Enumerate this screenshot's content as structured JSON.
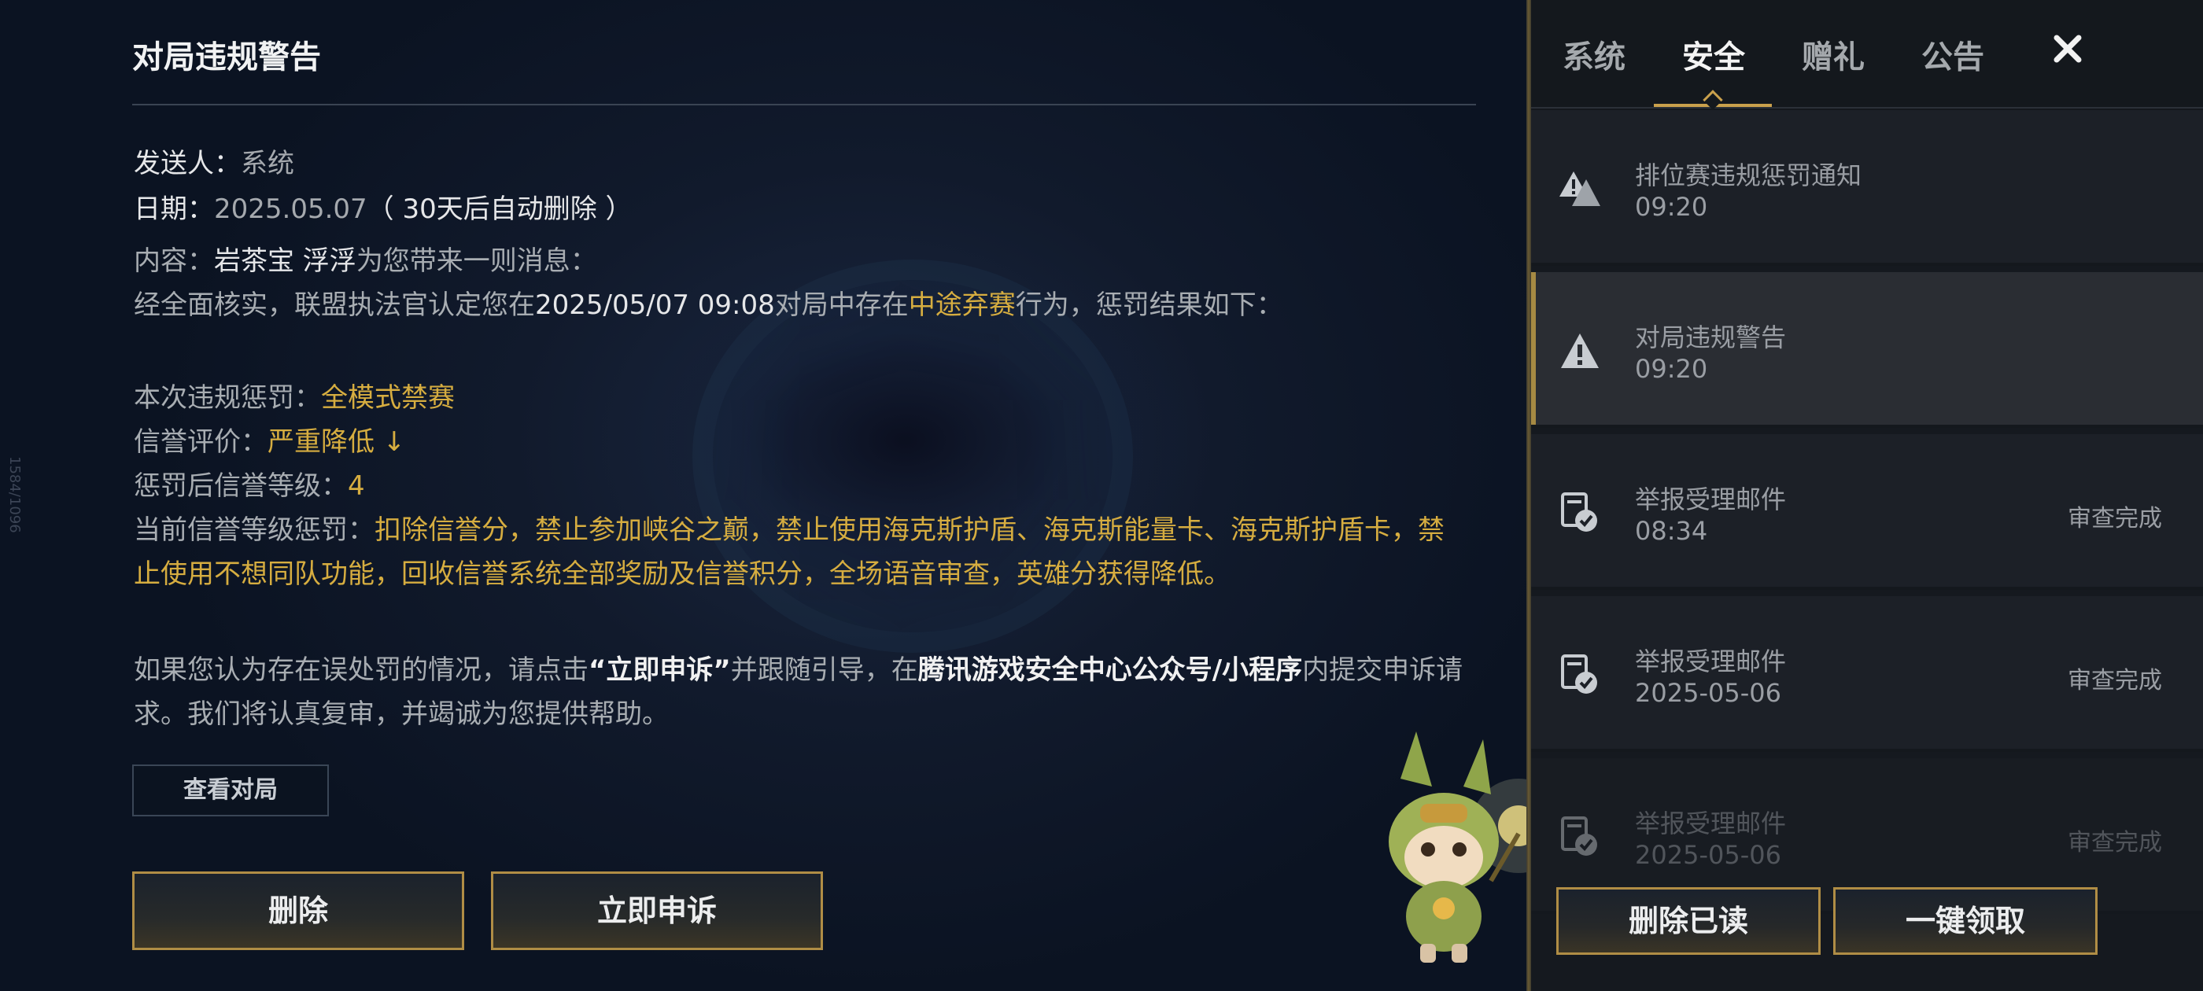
{
  "side_number": "1584/1096",
  "detail": {
    "title": "对局违规警告",
    "sender_label": "发送人：",
    "sender": "系统",
    "date_label": "日期：",
    "date": "2025.05.07",
    "auto_delete": "（ 30天后自动删除 ）",
    "content_label": "内容：",
    "content_from": "岩茶宝 浮浮",
    "content_from_suffix": "为您带来一则消息：",
    "verdict_pre": "经全面核实，联盟执法官认定您在",
    "verdict_time": "2025/05/07 09:08",
    "verdict_mid": "对局中存在",
    "verdict_behavior": "中途弃赛",
    "verdict_post": "行为，惩罚结果如下：",
    "penalty_label": "本次违规惩罚：",
    "penalty": "全模式禁赛",
    "credit_label": "信誉评价：",
    "credit": "严重降低 ↓",
    "level_label": "惩罚后信誉等级：",
    "level": "4",
    "current_label": "当前信誉等级惩罚：",
    "current": "扣除信誉分，禁止参加峡谷之巅，禁止使用海克斯护盾、海克斯能量卡、海克斯护盾卡，禁止使用不想同队功能，回收信誉系统全部奖励及信誉积分，全场语音审查，英雄分获得降低。",
    "appeal_pre": "如果您认为存在误处罚的情况，请点击",
    "appeal_link": "“立即申诉”",
    "appeal_mid": "并跟随引导，在",
    "appeal_center": "腾讯游戏安全中心公众号/小程序",
    "appeal_post": "内提交申诉请求。我们将认真复审，并竭诚为您提供帮助。",
    "view_match_label": "查看对局",
    "delete_label": "删除",
    "appeal_button_label": "立即申诉"
  },
  "tabs": [
    {
      "label": "系统",
      "active": false
    },
    {
      "label": "安全",
      "active": true
    },
    {
      "label": "赠礼",
      "active": false
    },
    {
      "label": "公告",
      "active": false
    }
  ],
  "mail_list": [
    {
      "icon": "warning-double-icon",
      "title": "排位赛违规惩罚通知",
      "time": "09:20",
      "status": ""
    },
    {
      "icon": "warning-icon",
      "title": "对局违规警告",
      "time": "09:20",
      "status": "",
      "selected": true
    },
    {
      "icon": "report-check-icon",
      "title": "举报受理邮件",
      "time": "08:34",
      "status": "审查完成"
    },
    {
      "icon": "report-check-icon",
      "title": "举报受理邮件",
      "time": "2025-05-06",
      "status": "审查完成"
    },
    {
      "icon": "report-check-icon",
      "title": "举报受理邮件",
      "time": "2025-05-06",
      "status": "审查完成"
    }
  ],
  "footer": {
    "delete_read_label": "删除已读",
    "claim_all_label": "一键领取"
  },
  "colors": {
    "accent_gold": "#d6ad40",
    "button_border": "#b08d45"
  }
}
